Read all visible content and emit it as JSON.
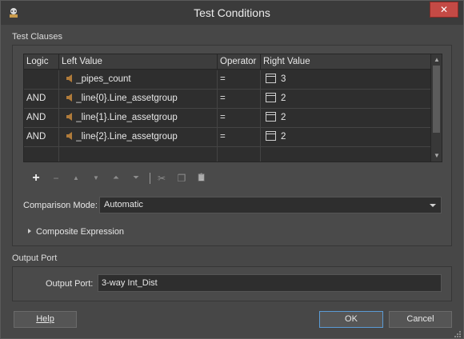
{
  "window": {
    "title": "Test Conditions",
    "close_glyph": "✕"
  },
  "test_clauses": {
    "group_label": "Test Clauses",
    "columns": [
      "Logic",
      "Left Value",
      "Operator",
      "Right Value"
    ],
    "rows": [
      {
        "logic": "",
        "left": "_pipes_count",
        "operator": "=",
        "right": "3"
      },
      {
        "logic": "AND",
        "left": "_line{0}.Line_assetgroup",
        "operator": "=",
        "right": "2"
      },
      {
        "logic": "AND",
        "left": "_line{1}.Line_assetgroup",
        "operator": "=",
        "right": "2"
      },
      {
        "logic": "AND",
        "left": "_line{2}.Line_assetgroup",
        "operator": "=",
        "right": "2"
      }
    ],
    "toolbar": {
      "add": "+",
      "remove": "−",
      "move_up": "▲",
      "move_down": "▼",
      "move_top": "⏶",
      "move_bottom": "⏷",
      "cut": "✂",
      "copy": "❐",
      "paste": "📋"
    },
    "comparison_mode_label": "Comparison Mode:",
    "comparison_mode_value": "Automatic",
    "composite_expression_label": "Composite Expression"
  },
  "output_port": {
    "group_label": "Output Port",
    "label": "Output Port:",
    "value": "3-way Int_Dist"
  },
  "buttons": {
    "help": "Help",
    "ok": "OK",
    "cancel": "Cancel"
  },
  "colors": {
    "arrow": "#b07b3a",
    "accent_border": "#5b9bd5",
    "close": "#c44a45"
  }
}
